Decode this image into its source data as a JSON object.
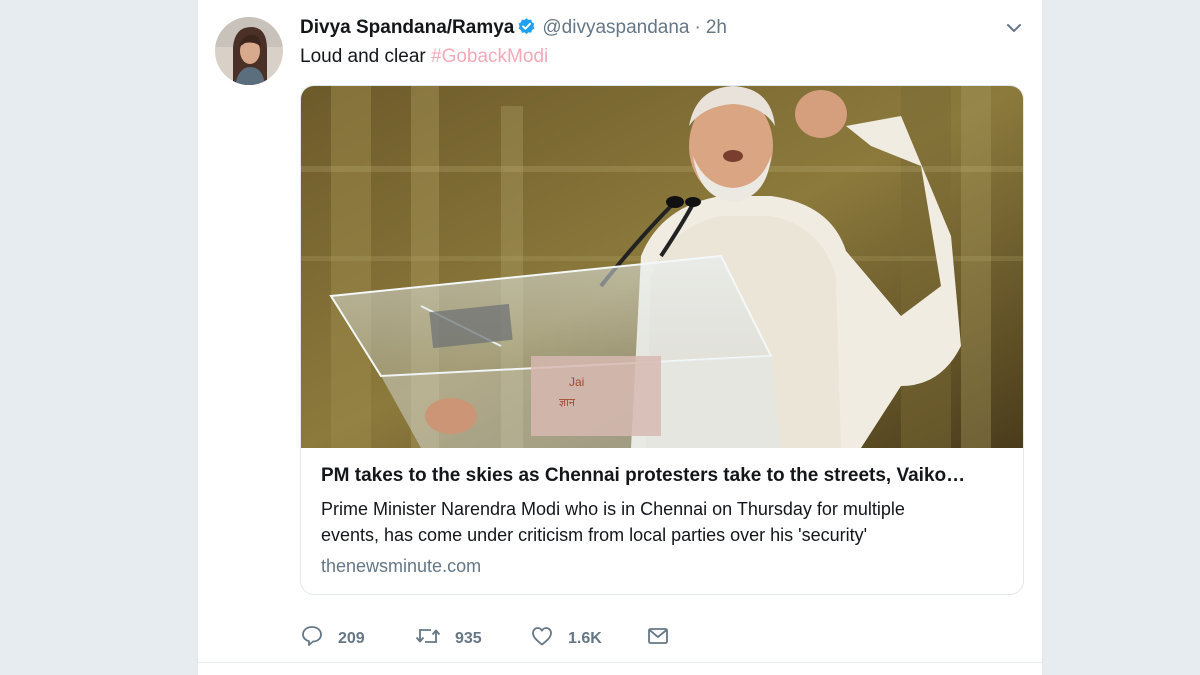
{
  "tweet": {
    "display_name": "Divya Spandana/Ramya",
    "handle": "@divyaspandana",
    "separator": "·",
    "time": "2h",
    "text": "Loud and clear ",
    "hashtag": "#GobackModi",
    "verified_icon": "verified-badge-icon",
    "caret_icon": "chevron-down-icon"
  },
  "card": {
    "title": "PM takes to the skies as Chennai protesters take to the streets, Vaiko…",
    "description_line1": "Prime Minister Narendra Modi who is in Chennai on Thursday for multiple",
    "description_line2": "events, has come under criticism from local parties over his 'security'",
    "domain": "thenewsminute.com",
    "podium_sign_line1": "Jai",
    "podium_sign_line2": "ज्ञान"
  },
  "actions": {
    "reply_count": "209",
    "retweet_count": "935",
    "like_count": "1.6K",
    "icons": [
      "reply-icon",
      "retweet-icon",
      "like-icon",
      "message-icon"
    ]
  },
  "colors": {
    "brand_blue": "#1da1f2",
    "hashtag": "#f4a9b8",
    "muted": "#657786",
    "text": "#14171a",
    "border": "#e1e8ed"
  }
}
